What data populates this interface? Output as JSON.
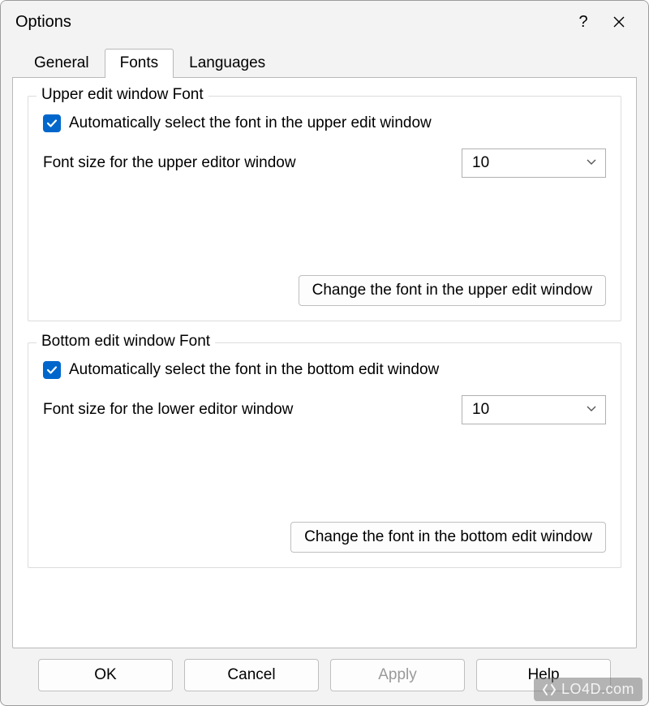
{
  "window": {
    "title": "Options",
    "help_tooltip": "?",
    "close_tooltip": "Close"
  },
  "tabs": {
    "general": "General",
    "fonts": "Fonts",
    "languages": "Languages",
    "active": "fonts"
  },
  "upper": {
    "legend": "Upper edit window Font",
    "auto_label": "Automatically select the font in the upper edit window",
    "auto_checked": true,
    "size_label": "Font size for the upper editor window",
    "size_value": "10",
    "change_btn": "Change the font in the upper edit window"
  },
  "bottom": {
    "legend": "Bottom edit window Font",
    "auto_label": "Automatically select the font in the bottom edit window",
    "auto_checked": true,
    "size_label": "Font size for the lower editor window",
    "size_value": "10",
    "change_btn": "Change the font in the bottom edit window"
  },
  "footer": {
    "ok": "OK",
    "cancel": "Cancel",
    "apply": "Apply",
    "help": "Help",
    "apply_enabled": false
  },
  "watermark": "LO4D.com"
}
